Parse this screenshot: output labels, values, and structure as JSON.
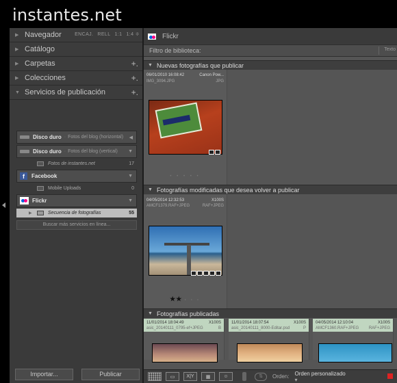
{
  "brand": "instantes.net",
  "left": {
    "navigator": {
      "label": "Navegador",
      "opts": [
        "ENCAJ.",
        "RELL",
        "1:1",
        "1:4 ≑"
      ]
    },
    "catalog": "Catálogo",
    "folders": "Carpetas",
    "collections": "Colecciones",
    "publish_services": "Servicios de publicación",
    "services": [
      {
        "name": "Disco duro",
        "sub": "Fotos del blog (horizontal)",
        "arrow": "◀"
      },
      {
        "name": "Disco duro",
        "sub": "Fotos del blog (vertical)",
        "arrow": "▼"
      },
      {
        "name": "Facebook",
        "arrow": "▼"
      },
      {
        "name": "Flickr",
        "arrow": "▼"
      }
    ],
    "collections_list": [
      {
        "label": "Fotos de instantes.net",
        "count": "17"
      },
      {
        "label": "Mobile Uploads",
        "count": "0"
      },
      {
        "label": "Secuencia de fotografías",
        "count": "55"
      }
    ],
    "more_services": "Buscar más servicios en línea...",
    "import_button": "Importar...",
    "publish_button": "Publicar"
  },
  "right": {
    "title": "Flickr",
    "filter_label": "Filtro de biblioteca:",
    "filter_text": "Texto",
    "sections": {
      "new": "Nuevas fotografías que publicar",
      "modified": "Fotografías modificadas que desea volver a publicar",
      "published": "Fotografías publicadas"
    },
    "new_photo": {
      "date": "06/01/2010 16:08:42",
      "camera": "Canon Pow...",
      "file": "IMG_3094.JPG",
      "type": "JPG",
      "dots": "• • • • •"
    },
    "modified_photo": {
      "date": "04/05/2014 12:32:53",
      "camera": "X100S",
      "file": "AMCF1379.RAF+JPEG",
      "type": "RAF+JPEG",
      "stars": "★★",
      "dots": "• • •"
    },
    "published_photos": [
      {
        "date": "11/01/2014 18:04:49",
        "camera": "X100S",
        "file": "asic_20140111_0795-ef+JPEG",
        "type": "B"
      },
      {
        "date": "11/01/2014 18:07:54",
        "camera": "X100S",
        "file": "asic_20140111_8000-Editar.psd",
        "type": "P"
      },
      {
        "date": "04/05/2014 12:10:04",
        "camera": "X100S",
        "file": "AMCF1360.RAF+JPEG",
        "type": "RAF+JPEG"
      }
    ],
    "toolbar": {
      "sort_label": "Orden:",
      "sort_value": "Orden personalizado",
      "compare": "X|Y"
    }
  }
}
